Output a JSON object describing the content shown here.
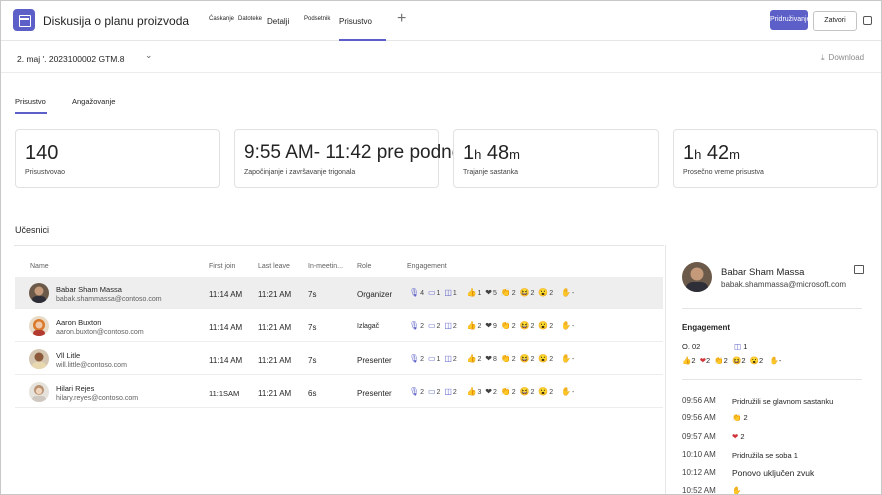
{
  "header": {
    "title": "Diskusija o planu proizvoda",
    "tabs": [
      "Ćaskanje",
      "Datoteke",
      "Detalji",
      "Podsetnik",
      "Prisustvo"
    ],
    "join_label": "Pridruživanje",
    "close_label": "Zatvori"
  },
  "subheader": {
    "date": "2. maj '. 2023100002 GTM.8",
    "download_label": "Download"
  },
  "inner_tabs": [
    "Prisustvo",
    "Angažovanje"
  ],
  "stats": [
    {
      "value": "140",
      "label": "Prisustvovao"
    },
    {
      "value": "9:55 AM- 11:42 pre podne",
      "label": "Započinjanje i  završavanje trigonala"
    },
    {
      "value": "1h 48m",
      "label": "Trajanje sastanka"
    },
    {
      "value": "1h 42m",
      "label": "Prosečno vreme prisustva"
    }
  ],
  "participants_title": "Učesnici",
  "columns": [
    "Name",
    "First join",
    "Last leave",
    "In-meetin...",
    "Role",
    "Engagement"
  ],
  "rows": [
    {
      "name": "Babar Sham Massa",
      "email": "babak.shammassa@contoso.com",
      "first": "11:14 AM",
      "last": "11:21 AM",
      "dur": "7s",
      "role": "Organizer",
      "mic": "4",
      "cam": "1",
      "scr": "1",
      "like": "1",
      "heart": "5",
      "clap": "2",
      "laugh": "2",
      "wow": "2",
      "hand": "-"
    },
    {
      "name": "Aaron Buxton",
      "email": "aaron.buxton@contoso.com",
      "first": "11:14 AM",
      "last": "11:21 AM",
      "dur": "7s",
      "role": "Izlagač",
      "mic": "2",
      "cam": "2",
      "scr": "2",
      "like": "2",
      "heart": "9",
      "clap": "2",
      "laugh": "2",
      "wow": "2",
      "hand": "-"
    },
    {
      "name": "Vll Litle",
      "email": "will.little@contoso.com",
      "first": "11:14 AM",
      "last": "11:21 AM",
      "dur": "7s",
      "role": "Presenter",
      "mic": "2",
      "cam": "1",
      "scr": "2",
      "like": "2",
      "heart": "8",
      "clap": "2",
      "laugh": "2",
      "wow": "2",
      "hand": "-"
    },
    {
      "name": "Hilari Rejes",
      "email": "hilary.reyes@contoso.com",
      "first": "11:1SAM",
      "last": "11:21 AM",
      "dur": "6s",
      "role": "Presenter",
      "mic": "2",
      "cam": "2",
      "scr": "2",
      "like": "3",
      "heart": "2",
      "clap": "2",
      "laugh": "2",
      "wow": "2",
      "hand": "-"
    }
  ],
  "panel": {
    "name": "Babar Sham Massa",
    "email": "babak.shammassa@microsoft.com",
    "engagement_label": "Engagement",
    "eng_summary": "O. 02",
    "eng_scr": "1",
    "eng_like": "2",
    "eng_heart": "2",
    "eng_clap": "2",
    "eng_laugh": "2",
    "eng_wow": "2",
    "eng_hand": "-",
    "timeline": [
      {
        "time": "09:56 AM",
        "text": "Pridružili se glavnom sastanku"
      },
      {
        "time": "09:56 AM",
        "text": "2"
      },
      {
        "time": "09:57 AM",
        "text": "2"
      },
      {
        "time": "10:10 AM",
        "text": "Pridružila se soba 1"
      },
      {
        "time": "10:12 AM",
        "text": "Ponovo uključen zvuk"
      },
      {
        "time": "10:52 AM",
        "text": ""
      }
    ]
  }
}
